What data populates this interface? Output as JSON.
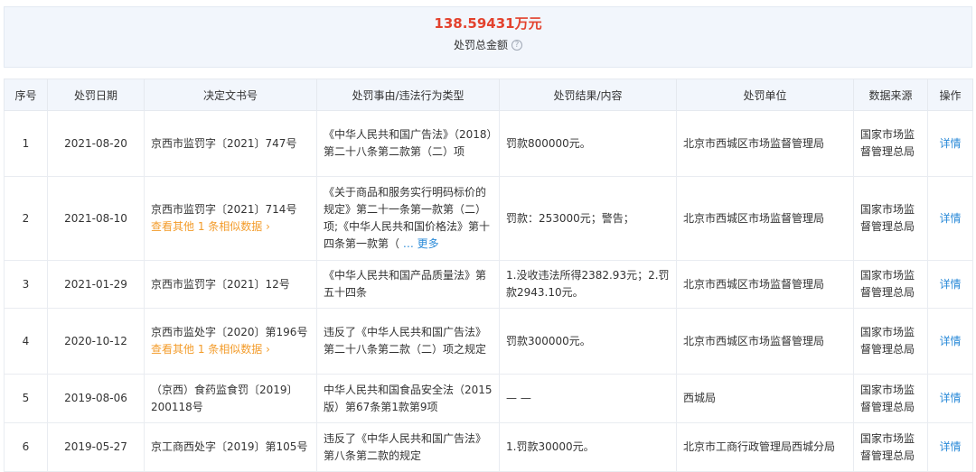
{
  "summary": {
    "amount": "138.59431万元",
    "label": "处罚总金额",
    "help_icon": "?"
  },
  "table": {
    "headers": [
      "序号",
      "处罚日期",
      "决定文书号",
      "处罚事由/违法行为类型",
      "处罚结果/内容",
      "处罚单位",
      "数据来源",
      "操作"
    ],
    "rows": [
      {
        "no": "1",
        "date": "2021-08-20",
        "doc": "京西市监罚字〔2021〕747号",
        "similar": "",
        "reason": "《中华人民共和国广告法》（2018）第二十八条第二款第（二）项",
        "more": "",
        "result": "罚款800000元。",
        "unit": "北京市西城区市场监督管理局",
        "source": "国家市场监督管理总局",
        "action": "详情"
      },
      {
        "no": "2",
        "date": "2021-08-10",
        "doc": "京西市监罚字〔2021〕714号",
        "similar": "查看其他 1 条相似数据 ›",
        "reason": "《关于商品和服务实行明码标价的规定》第二十一条第一款第（二）项;《中华人民共和国价格法》第十四条第一款第（",
        "more": "… 更多",
        "result": "罚款：253000元；警告；",
        "unit": "北京市西城区市场监督管理局",
        "source": "国家市场监督管理总局",
        "action": "详情"
      },
      {
        "no": "3",
        "date": "2021-01-29",
        "doc": "京西市监罚字〔2021〕12号",
        "similar": "",
        "reason": "《中华人民共和国产品质量法》第五十四条",
        "more": "",
        "result": "1.没收违法所得2382.93元；2.罚款2943.10元。",
        "unit": "北京市西城区市场监督管理局",
        "source": "国家市场监督管理总局",
        "action": "详情"
      },
      {
        "no": "4",
        "date": "2020-10-12",
        "doc": "京西市监处字〔2020〕第196号",
        "similar": "查看其他 1 条相似数据 ›",
        "reason": "违反了《中华人民共和国广告法》第二十八条第二款（二）项之规定",
        "more": "",
        "result": "罚款300000元。",
        "unit": "北京市西城区市场监督管理局",
        "source": "国家市场监督管理总局",
        "action": "详情"
      },
      {
        "no": "5",
        "date": "2019-08-06",
        "doc": "（京西）食药监食罚〔2019〕200118号",
        "similar": "",
        "reason": "中华人民共和国食品安全法（2015版）第67条第1款第9项",
        "more": "",
        "result": "— —",
        "unit": "西城局",
        "source": "国家市场监督管理总局",
        "action": "详情"
      },
      {
        "no": "6",
        "date": "2019-05-27",
        "doc": "京工商西处字〔2019〕第105号",
        "similar": "",
        "reason": "违反了《中华人民共和国广告法》第八条第二款的规定",
        "more": "",
        "result": "1.罚款30000元。",
        "unit": "北京市工商行政管理局西城分局",
        "source": "国家市场监督管理总局",
        "action": "详情"
      }
    ]
  },
  "colors": {
    "amount": "#e3422e",
    "link": "#2a8ad8",
    "similar": "#f39c2b",
    "header_bg": "#f2f6fc"
  }
}
